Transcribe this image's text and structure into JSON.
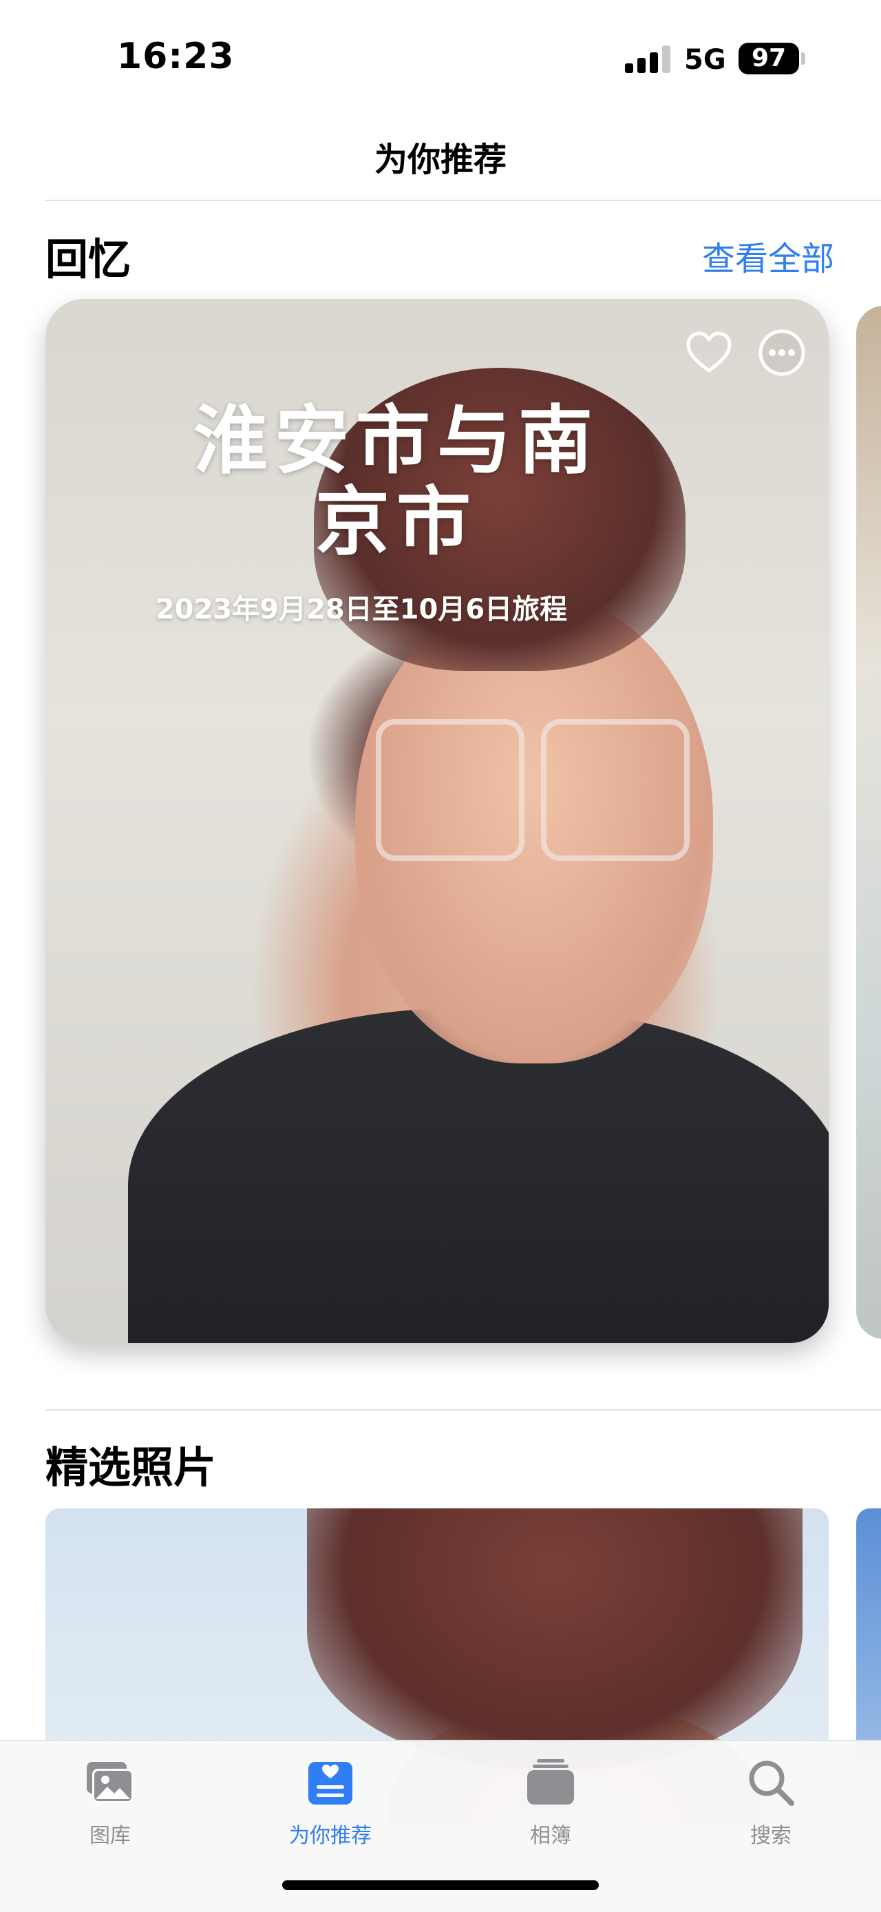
{
  "status_bar": {
    "time": "16:23",
    "network": "5G",
    "battery": "97"
  },
  "nav": {
    "title": "为你推荐"
  },
  "memories": {
    "section_title": "回忆",
    "see_all": "查看全部",
    "card": {
      "title": "淮安市与南京市",
      "subtitle": "2023年9月28日至10月6日旅程"
    }
  },
  "featured": {
    "section_title": "精选照片"
  },
  "tab_bar": {
    "items": [
      {
        "label": "图库",
        "icon": "photo-library-icon",
        "active": false
      },
      {
        "label": "为你推荐",
        "icon": "for-you-icon",
        "active": true
      },
      {
        "label": "相簿",
        "icon": "albums-icon",
        "active": false
      },
      {
        "label": "搜索",
        "icon": "search-icon",
        "active": false
      }
    ]
  },
  "colors": {
    "accent": "#2f7ef3",
    "inactive": "#8e8e93"
  }
}
